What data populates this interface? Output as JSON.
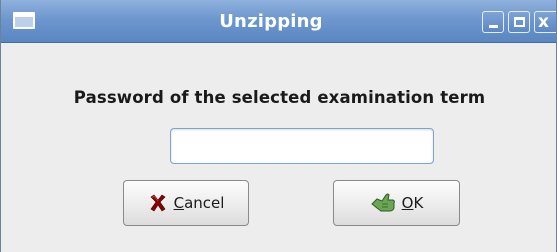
{
  "window": {
    "title": "Unzipping",
    "minimize_symbol": "_",
    "maximize_symbol": "□",
    "close_symbol": "x"
  },
  "dialog": {
    "prompt": "Password of the selected examination term",
    "password_value": "",
    "cancel_label_mnemonic": "C",
    "cancel_label_rest": "ancel",
    "ok_label_mnemonic": "O",
    "ok_label_rest": "K"
  },
  "icons": {
    "window": "window-icon",
    "cancel": "cancel-x-icon",
    "ok": "ok-hand-icon"
  },
  "colors": {
    "titlebar": "#6d97ce",
    "cancel_icon": "#8b0000",
    "ok_icon": "#4b8a3a"
  }
}
